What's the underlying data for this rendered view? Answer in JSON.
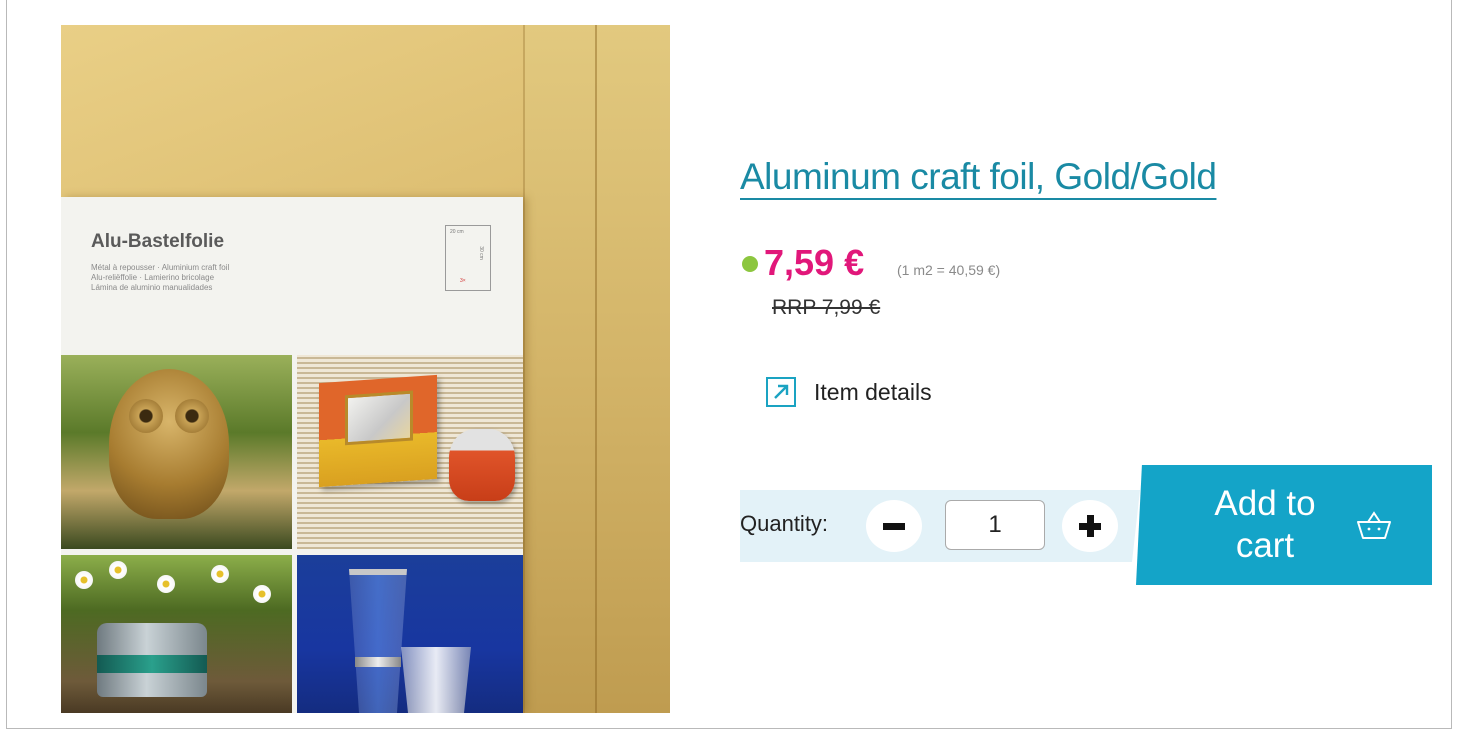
{
  "product": {
    "title": "Aluminum craft foil, Gold/Gold",
    "price": "7,59 €",
    "unit_price": "(1 m2 = 40,59 €)",
    "rrp": "RRP 7,99 €",
    "stock_color": "#8cc63f",
    "price_color": "#e1177a",
    "link_color": "#1a8aa4"
  },
  "image": {
    "pack_title": "Alu-Bastelfolie",
    "pack_subtitle": "Métal à repousser · Aluminium craft foil\nAlu-reliëffolie · Lamierino bricolage\nLámina de aluminio manualidades",
    "pack_size_w": "20 cm",
    "pack_size_h": "30 cm",
    "pack_qty": "3×"
  },
  "details": {
    "label": "Item details",
    "icon": "external-link-arrow-icon"
  },
  "quantity": {
    "label": "Quantity:",
    "value": "1",
    "minus_icon": "minus-icon",
    "plus_icon": "plus-icon"
  },
  "cart": {
    "label": "Add to cart",
    "icon": "basket-icon",
    "button_color": "#14a4c8"
  }
}
